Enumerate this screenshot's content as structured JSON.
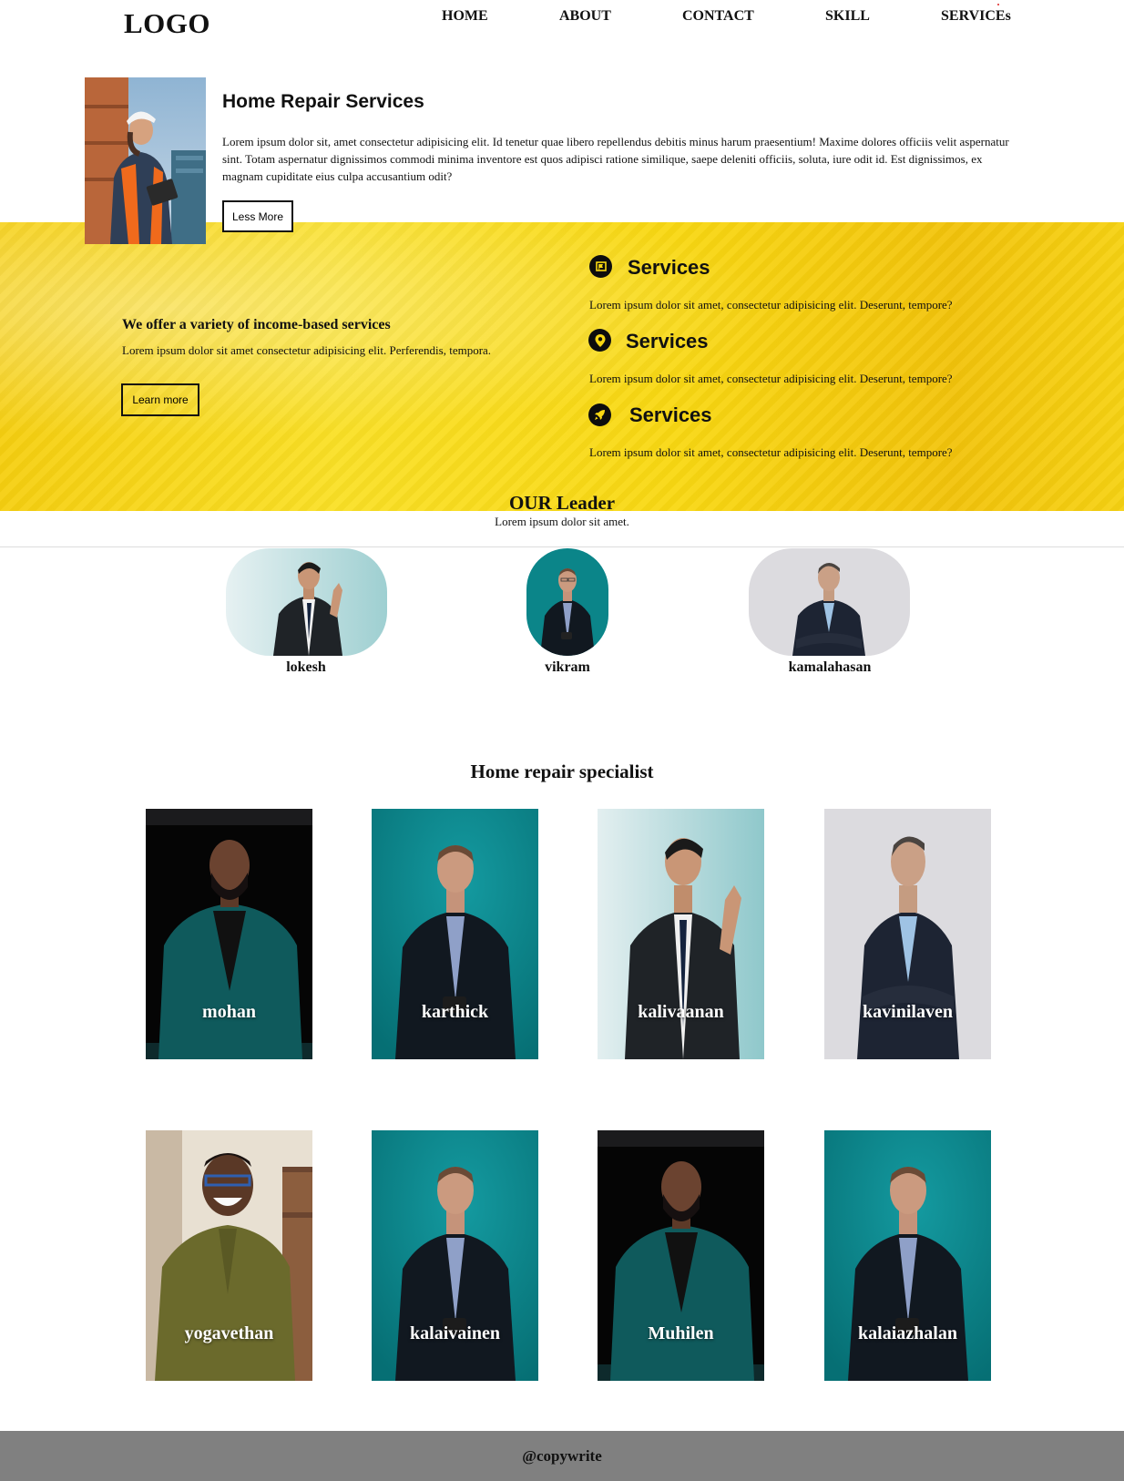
{
  "header": {
    "logo": "LOGO",
    "nav": [
      "HOME",
      "ABOUT",
      "CONTACT",
      "SKILL",
      "SERVICEs"
    ]
  },
  "intro": {
    "title": "Home Repair Services",
    "text": "Lorem ipsum dolor sit, amet consectetur adipisicing elit. Id tenetur quae libero repellendus debitis minus harum praesentium! Maxime dolores officiis velit aspernatur sint. Totam aspernatur dignissimos commodi minima inventore est quos adipisci ratione similique, saepe deleniti officiis, soluta, iure odit id. Est dignissimos, ex magnam cupiditate eius culpa accusantium odit?",
    "button": "Less More"
  },
  "offer": {
    "title": "We offer a variety of income-based services",
    "text": "Lorem ipsum dolor sit amet consectetur adipisicing elit. Perferendis, tempora.",
    "button": "Learn more"
  },
  "services": [
    {
      "icon": "flag-icon",
      "title": "Services",
      "text": "Lorem ipsum dolor sit amet, consectetur adipisicing elit. Deserunt, tempore?"
    },
    {
      "icon": "map-pin-icon",
      "title": "Services",
      "text": "Lorem ipsum dolor sit amet, consectetur adipisicing elit. Deserunt, tempore?"
    },
    {
      "icon": "rocket-icon",
      "title": "Services",
      "text": "Lorem ipsum dolor sit amet, consectetur adipisicing elit. Deserunt, tempore?"
    }
  ],
  "leaders": {
    "heading": "OUR Leader",
    "subtitle": "Lorem ipsum dolor sit amet.",
    "people": [
      {
        "name": "lokesh"
      },
      {
        "name": "vikram"
      },
      {
        "name": "kamalahasan"
      }
    ]
  },
  "specialists": {
    "heading": "Home repair specialist",
    "people": [
      {
        "name": "mohan"
      },
      {
        "name": "karthick"
      },
      {
        "name": "kalivaanan"
      },
      {
        "name": "kavinilaven"
      },
      {
        "name": "yogavethan"
      },
      {
        "name": "kalaivainen"
      },
      {
        "name": "Muhilen"
      },
      {
        "name": "kalaiazhalan"
      }
    ]
  },
  "colors": {
    "band_yellow": "#f9d812",
    "teal_backdrop": "#0a8a8c",
    "footer_gray": "#808080"
  },
  "footer": {
    "text": "@copywrite"
  }
}
